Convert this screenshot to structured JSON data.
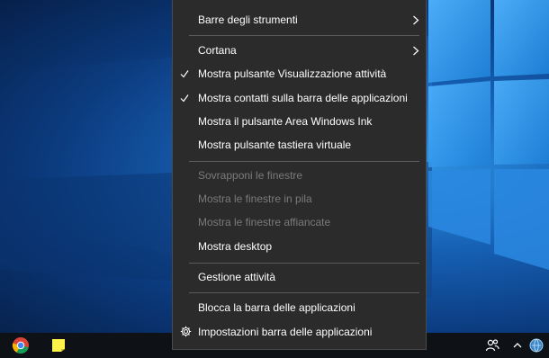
{
  "context_menu": {
    "items": [
      {
        "label": "Barre degli strumenti",
        "submenu": true
      },
      {
        "label": "Cortana",
        "submenu": true
      },
      {
        "label": "Mostra pulsante Visualizzazione attività",
        "checked": true
      },
      {
        "label": "Mostra contatti sulla barra delle applicazioni",
        "checked": true
      },
      {
        "label": "Mostra il pulsante Area Windows Ink"
      },
      {
        "label": "Mostra pulsante tastiera virtuale"
      },
      {
        "label": "Sovrapponi le finestre",
        "disabled": true
      },
      {
        "label": "Mostra le finestre in pila",
        "disabled": true
      },
      {
        "label": "Mostra le finestre affiancate",
        "disabled": true
      },
      {
        "label": "Mostra desktop"
      },
      {
        "label": "Gestione attività"
      },
      {
        "label": "Blocca la barra delle applicazioni"
      },
      {
        "label": "Impostazioni barra delle applicazioni",
        "icon": "gear-icon"
      }
    ]
  },
  "taskbar": {
    "pinned_icons": [
      "chrome-icon",
      "sticky-notes-icon"
    ],
    "tray_icons": [
      "people-icon",
      "chevron-up-icon",
      "network-icon"
    ]
  },
  "colors": {
    "menu_background": "#2b2b2b",
    "menu_text": "#ffffff",
    "menu_text_disabled": "#7a7a7a",
    "separator": "#5a5a5a",
    "taskbar": "#0e1216",
    "wallpaper_blue": "#1660b4"
  }
}
